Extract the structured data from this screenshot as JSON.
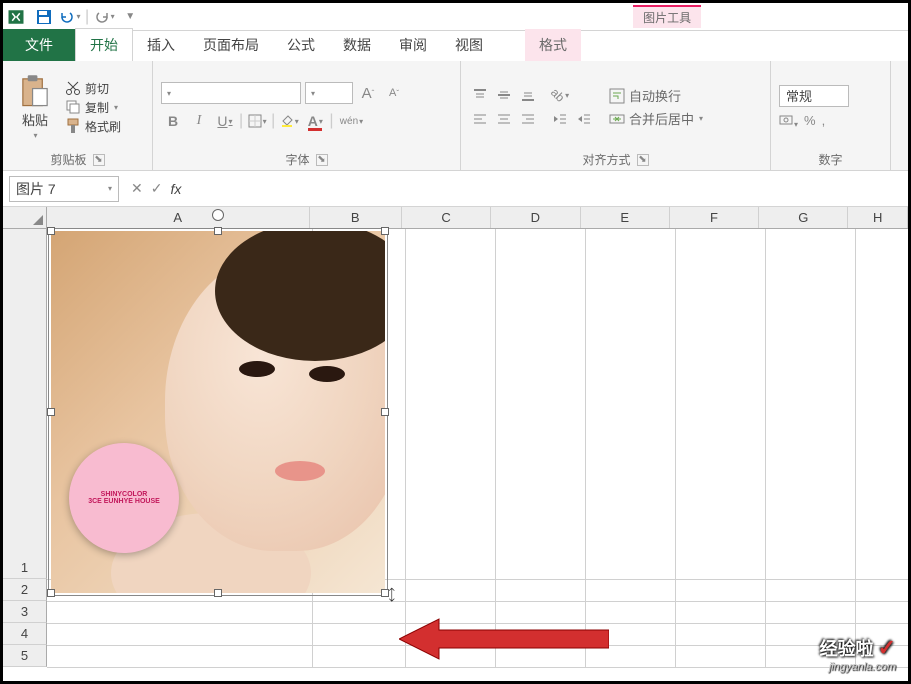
{
  "title_context_tab": "图片工具",
  "tabs": {
    "file": "文件",
    "home": "开始",
    "insert": "插入",
    "layout": "页面布局",
    "formulas": "公式",
    "data": "数据",
    "review": "审阅",
    "view": "视图",
    "format": "格式"
  },
  "clipboard": {
    "paste": "粘贴",
    "cut": "剪切",
    "copy": "复制",
    "format_painter": "格式刷",
    "group_label": "剪贴板"
  },
  "font": {
    "bold": "B",
    "italic": "I",
    "underline": "U",
    "wen": "wén",
    "grow": "A",
    "shrink": "A",
    "group_label": "字体"
  },
  "alignment": {
    "wrap_text": "自动换行",
    "merge_center": "合并后居中",
    "group_label": "对齐方式"
  },
  "number": {
    "format": "常规",
    "group_label": "数字",
    "percent": "%",
    "comma": ","
  },
  "namebox": "图片 7",
  "fx": "fx",
  "columns": {
    "A": "A",
    "B": "B",
    "C": "C",
    "D": "D",
    "E": "E",
    "F": "F",
    "G": "G",
    "H": "H"
  },
  "rows": {
    "1": "1",
    "2": "2",
    "3": "3",
    "4": "4",
    "5": "5"
  },
  "product": {
    "brand": "SHINYCOLOR",
    "line": "3CE EUNHYE HOUSE"
  },
  "watermark": {
    "text": "经验啦",
    "url": "jingyanla.com",
    "check": "✓"
  }
}
